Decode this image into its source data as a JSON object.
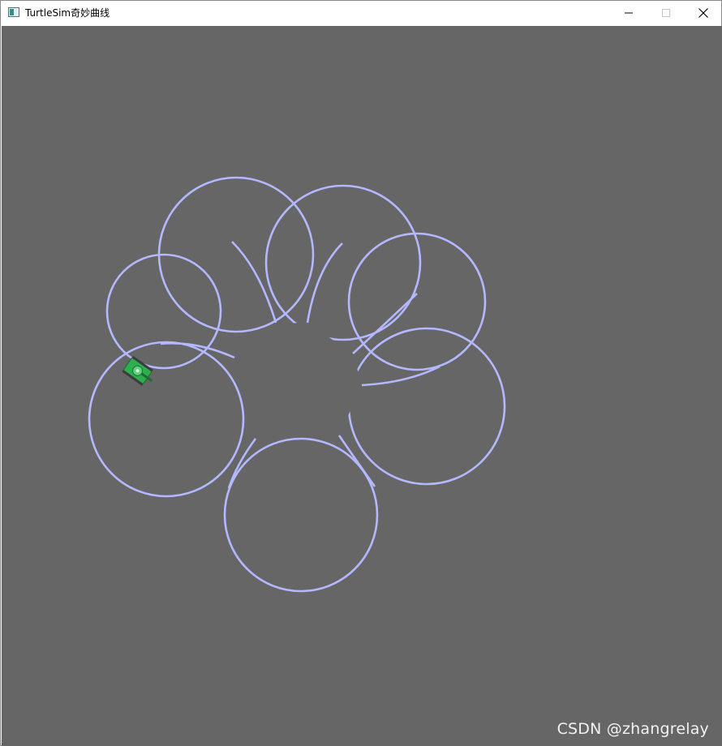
{
  "window": {
    "title": "TurtleSim奇妙曲线",
    "icon": "window-app-icon",
    "buttons": {
      "minimize": "minimize-icon",
      "maximize": "maximize-icon",
      "close": "close-icon"
    }
  },
  "canvas": {
    "background_color": "#666666",
    "pen_color": "#b3b8ff",
    "turtle": {
      "icon": "turtle-tank-icon",
      "color": "#2fae4f"
    }
  },
  "watermark": {
    "text": "CSDN @zhangrelay"
  }
}
